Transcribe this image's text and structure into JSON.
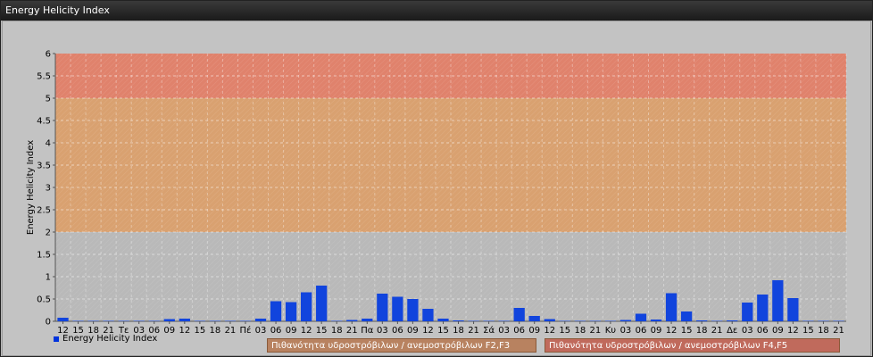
{
  "window": {
    "title": "Energy Helicity Index"
  },
  "legend": {
    "series_label": "Energy Helicity Index"
  },
  "bands": [
    {
      "label": "Πιθανότητα υδροστρόβιλων / ανεμοστρόβιλων F2,F3",
      "color": "#b88260"
    },
    {
      "label": "Πιθανότητα υδροστρόβιλων / ανεμοστρόβιλων F4,F5",
      "color": "#c06a5c"
    }
  ],
  "colors": {
    "bar": "#1144dd",
    "zone_low": "#b9b9b9",
    "zone_mid": "#d9a170",
    "zone_high": "#e0826c"
  },
  "chart_data": {
    "type": "bar",
    "title": "",
    "xlabel": "",
    "ylabel": "Energy Helicity Index",
    "ylim": [
      0,
      6
    ],
    "yticks": [
      "0",
      "0.5",
      "1",
      "1.5",
      "2",
      "2.5",
      "3",
      "3.5",
      "4",
      "4.5",
      "5",
      "5.5",
      "6"
    ],
    "grid": true,
    "legend_position": "bottom-left",
    "zones": [
      {
        "from": 0,
        "to": 2,
        "level": "low"
      },
      {
        "from": 2,
        "to": 5,
        "level": "mid"
      },
      {
        "from": 5,
        "to": 6,
        "level": "high"
      }
    ],
    "categories": [
      "12",
      "15",
      "18",
      "21",
      "Τε",
      "03",
      "06",
      "09",
      "12",
      "15",
      "18",
      "21",
      "Πέ",
      "03",
      "06",
      "09",
      "12",
      "15",
      "18",
      "21",
      "Πα",
      "03",
      "06",
      "09",
      "12",
      "15",
      "18",
      "21",
      "Σά",
      "03",
      "06",
      "09",
      "12",
      "15",
      "18",
      "21",
      "Κυ",
      "03",
      "06",
      "09",
      "12",
      "15",
      "18",
      "21",
      "Δε",
      "03",
      "06",
      "09",
      "12",
      "15",
      "18",
      "21"
    ],
    "series": [
      {
        "name": "Energy Helicity Index",
        "values": [
          0.08,
          0.01,
          0.01,
          0.01,
          0.01,
          0.01,
          0.01,
          0.05,
          0.06,
          0.01,
          0.01,
          0.01,
          0.01,
          0.06,
          0.45,
          0.43,
          0.65,
          0.8,
          0.01,
          0.03,
          0.06,
          0.62,
          0.55,
          0.5,
          0.28,
          0.06,
          0.02,
          0.01,
          0.01,
          0.01,
          0.3,
          0.12,
          0.05,
          0.01,
          0.01,
          0.01,
          0.01,
          0.03,
          0.17,
          0.04,
          0.63,
          0.22,
          0.02,
          0.01,
          0.02,
          0.42,
          0.6,
          0.92,
          0.52,
          0.01,
          0.01,
          0.01
        ]
      }
    ]
  }
}
